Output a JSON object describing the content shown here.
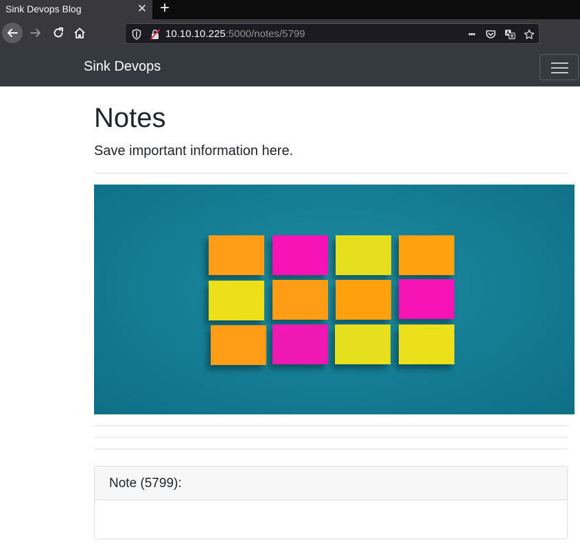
{
  "browser": {
    "tab_title": "Sink Devops Blog",
    "tab_close": "✕",
    "new_tab": "+",
    "url_host": "10.10.10.225",
    "url_rest": ":5000/notes/5799",
    "more_icon": "•••"
  },
  "navbar": {
    "brand": "Sink Devops"
  },
  "page": {
    "title": "Notes",
    "subtitle": "Save important information here."
  },
  "photo": {
    "background": "#167f95",
    "notes": [
      {
        "row": 1,
        "col": 1,
        "color": "#ff9e16"
      },
      {
        "row": 1,
        "col": 2,
        "color": "#f513b5"
      },
      {
        "row": 1,
        "col": 3,
        "color": "#e6df1d"
      },
      {
        "row": 1,
        "col": 4,
        "color": "#ffa20d"
      },
      {
        "row": 2,
        "col": 1,
        "color": "#eddf1a"
      },
      {
        "row": 2,
        "col": 2,
        "color": "#ff9e16"
      },
      {
        "row": 2,
        "col": 3,
        "color": "#ffa00d"
      },
      {
        "row": 2,
        "col": 4,
        "color": "#f513b5"
      },
      {
        "row": 3,
        "col": 1,
        "color": "#ff9e16"
      },
      {
        "row": 3,
        "col": 2,
        "color": "#f018b3"
      },
      {
        "row": 3,
        "col": 3,
        "color": "#e6df1d"
      },
      {
        "row": 3,
        "col": 4,
        "color": "#ebe01b"
      }
    ]
  },
  "note_card": {
    "title": "Note (5799):",
    "body": ""
  },
  "colors": {
    "navbar_bg": "#343a40",
    "browser_toolbar": "#38383d",
    "text": "#212529"
  }
}
